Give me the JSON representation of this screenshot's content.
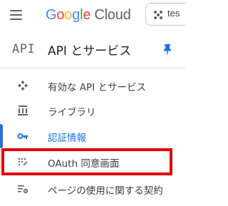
{
  "header": {
    "logo_letters": [
      "G",
      "o",
      "o",
      "g",
      "l",
      "e"
    ],
    "logo_product": "Cloud",
    "project_text": "tes"
  },
  "section": {
    "badge": "API",
    "title": "API とサービス"
  },
  "nav": {
    "items": [
      {
        "label": "有効な API とサービス",
        "icon": "enabled-apis-icon"
      },
      {
        "label": "ライブラリ",
        "icon": "library-icon"
      },
      {
        "label": "認証情報",
        "icon": "key-icon",
        "active": true
      },
      {
        "label": "OAuth 同意画面",
        "icon": "oauth-consent-icon",
        "highlighted": true
      },
      {
        "label": "ページの使用に関する契約",
        "icon": "page-usage-icon"
      }
    ]
  },
  "colors": {
    "accent": "#1a73e8",
    "highlight": "#e00000",
    "text": "#3c4043",
    "icon": "#5f6368"
  }
}
